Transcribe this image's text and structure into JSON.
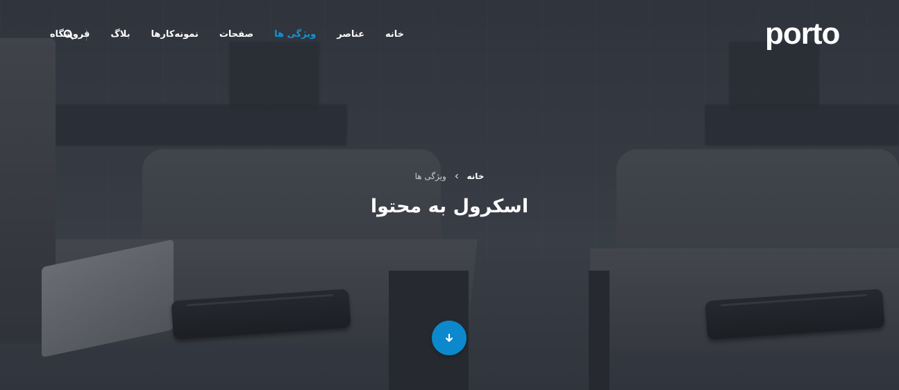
{
  "brand": {
    "logo_text": "porto"
  },
  "nav": {
    "items": [
      {
        "label": "خانه",
        "active": false
      },
      {
        "label": "عناصر",
        "active": false
      },
      {
        "label": "ویژگی ها",
        "active": true
      },
      {
        "label": "صفحات",
        "active": false
      },
      {
        "label": "نمونه‌کارها",
        "active": false
      },
      {
        "label": "بلاگ",
        "active": false
      },
      {
        "label": "فروشگاه",
        "active": false
      }
    ],
    "search_icon": "search-icon",
    "active_color": "#1793d1"
  },
  "breadcrumb": {
    "home": "خانه",
    "current": "ویژگی ها",
    "separator_icon": "chevron-left-icon"
  },
  "hero": {
    "title": "اسکرول به محتوا",
    "scroll_button_icon": "arrow-down-icon",
    "scroll_button_color": "#0c88cc"
  }
}
